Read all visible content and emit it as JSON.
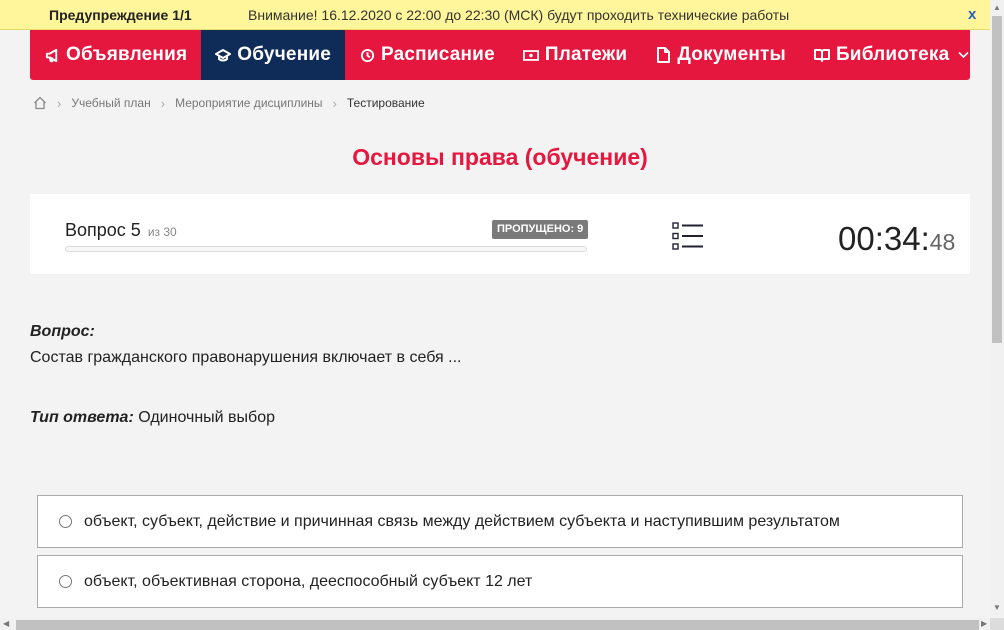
{
  "warning": {
    "count": "Предупреждение 1/1",
    "text": "Внимание! 16.12.2020 с 22:00 до 22:30 (МСК) будут проходить технические работы",
    "close": "x"
  },
  "nav": {
    "items": [
      {
        "label": "Объявления",
        "icon": "megaphone-icon",
        "active": false
      },
      {
        "label": "Обучение",
        "icon": "graduation-cap-icon",
        "active": true
      },
      {
        "label": "Расписание",
        "icon": "clock-icon",
        "active": false
      },
      {
        "label": "Платежи",
        "icon": "money-icon",
        "active": false
      },
      {
        "label": "Документы",
        "icon": "document-icon",
        "active": false
      },
      {
        "label": "Библиотека",
        "icon": "book-icon",
        "active": false
      }
    ],
    "colors": {
      "bar": "#e5173f",
      "active": "#0f2b57"
    }
  },
  "breadcrumb": {
    "items": [
      "Учебный план",
      "Мероприятие дисциплины",
      "Тестирование"
    ]
  },
  "page": {
    "title": "Основы права (обучение)"
  },
  "quiz": {
    "question_label": "Вопрос 5",
    "question_total": "из 30",
    "skipped": "ПРОПУЩЕНО: 9",
    "progress": 0,
    "timer_main": "00:34:",
    "timer_sec": "48"
  },
  "question": {
    "heading": "Вопрос:",
    "text": "Состав гражданского правонарушения включает в себя ...",
    "answer_type_label": "Тип ответа:",
    "answer_type_value": "Одиночный выбор"
  },
  "options": [
    {
      "text": "объект, субъект, действие и причинная связь между действием субъекта и наступившим результатом",
      "selected": false
    },
    {
      "text": "объект, объективная сторона, дееспособный субъект 12 лет",
      "selected": false
    }
  ]
}
